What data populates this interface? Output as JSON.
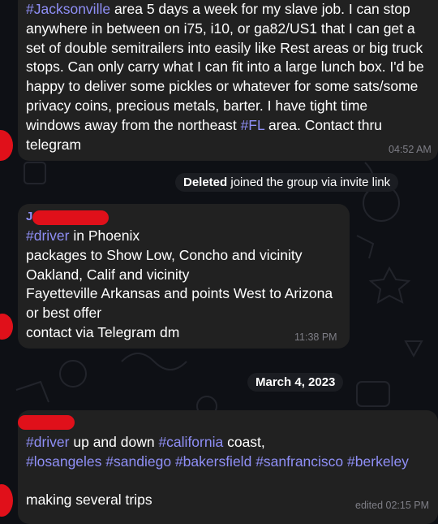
{
  "colors": {
    "background": "#0e1015",
    "bubble": "#212121",
    "hashtag": "#8f8ff6",
    "timestamp": "#7e7e86",
    "redaction": "#e0101a",
    "sender_name_fragment": "#8f8ff6"
  },
  "messages": [
    {
      "lines": [
        [
          {
            "t": "#Jacksonville",
            "tag": true
          },
          {
            "t": " area 5 days a week for my slave job. I can stop"
          }
        ],
        [
          {
            "t": "anywhere in between on i75, i10, or ga82/US1 that I can get a"
          }
        ],
        [
          {
            "t": "set of double semitrailers into easily like Rest areas or big truck"
          }
        ],
        [
          {
            "t": "stops. Can only carry what I can fit into a large lunch box. I'd be"
          }
        ],
        [
          {
            "t": "happy to deliver some pickles or whatever for some sats/some"
          }
        ],
        [
          {
            "t": "privacy coins, precious metals, barter. I have tight time"
          }
        ],
        [
          {
            "t": "windows away from the northeast "
          },
          {
            "t": "#FL",
            "tag": true
          },
          {
            "t": " area. Contact thru"
          }
        ],
        [
          {
            "t": "telegram"
          }
        ]
      ],
      "time": "04:52 AM"
    }
  ],
  "service_join": {
    "name": "Deleted",
    "action": " joined the group via invite link"
  },
  "message2": {
    "sender_fragment": "J",
    "lines": [
      [
        {
          "t": "#driver",
          "tag": true
        },
        {
          "t": " in Phoenix"
        }
      ],
      [
        {
          "t": "packages to Show Low, Concho and vicinity"
        }
      ],
      [
        {
          "t": "Oakland, Calif and vicinity"
        }
      ],
      [
        {
          "t": "Fayetteville Arkansas and points West to Arizona"
        }
      ],
      [
        {
          "t": "or best offer"
        }
      ],
      [
        {
          "t": "contact via Telegram dm"
        }
      ]
    ],
    "time": "11:38 PM"
  },
  "date_divider": "March 4, 2023",
  "message3": {
    "lines": [
      [
        {
          "t": "#driver",
          "tag": true
        },
        {
          "t": " up and down "
        },
        {
          "t": "#california",
          "tag": true
        },
        {
          "t": " coast,"
        }
      ],
      [
        {
          "t": "#losangeles",
          "tag": true
        },
        {
          "t": " "
        },
        {
          "t": "#sandiego",
          "tag": true
        },
        {
          "t": " "
        },
        {
          "t": "#bakersfield",
          "tag": true
        },
        {
          "t": " "
        },
        {
          "t": "#sanfrancisco",
          "tag": true
        },
        {
          "t": " "
        },
        {
          "t": "#berkeley",
          "tag": true
        }
      ],
      [
        {
          "t": ""
        }
      ],
      [
        {
          "t": "making several trips"
        }
      ]
    ],
    "time": "edited 02:15 PM"
  },
  "icons": [
    "chat-wallpaper-pattern",
    "avatar"
  ]
}
